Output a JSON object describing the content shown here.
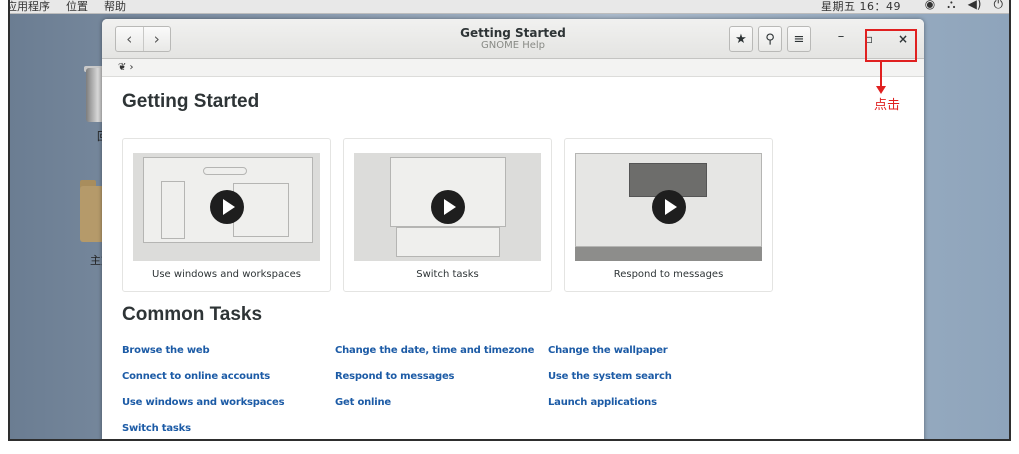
{
  "top_panel": {
    "menus": [
      "应用程序",
      "位置",
      "帮助"
    ],
    "clock": "星期五 16：49",
    "tray_icons": [
      "accessibility-icon",
      "network-icon",
      "volume-icon",
      "power-icon"
    ]
  },
  "desktop": {
    "trash_label": "回",
    "folder_label": "主文"
  },
  "window": {
    "title": "Getting Started",
    "subtitle": "GNOME Help",
    "nav_back": "‹",
    "nav_forward": "›",
    "bookmark_icon": "★",
    "search_icon": "⚲",
    "menu_icon": "≡",
    "minimize": "–",
    "maximize": "▫",
    "close": "×",
    "path": "❦ ›"
  },
  "content": {
    "getting_started_heading": "Getting Started",
    "common_tasks_heading": "Common Tasks",
    "videos": [
      "Use windows and workspaces",
      "Switch tasks",
      "Respond to messages"
    ],
    "tasks": [
      [
        "Browse the web",
        "Change the date, time and timezone",
        "Change the wallpaper"
      ],
      [
        "Connect to online accounts",
        "Respond to messages",
        "Use the system search"
      ],
      [
        "Use windows and workspaces",
        "Get online",
        "Launch applications"
      ],
      [
        "Switch tasks"
      ]
    ]
  },
  "annotation": {
    "label": "点击",
    "color": "#e02020"
  }
}
